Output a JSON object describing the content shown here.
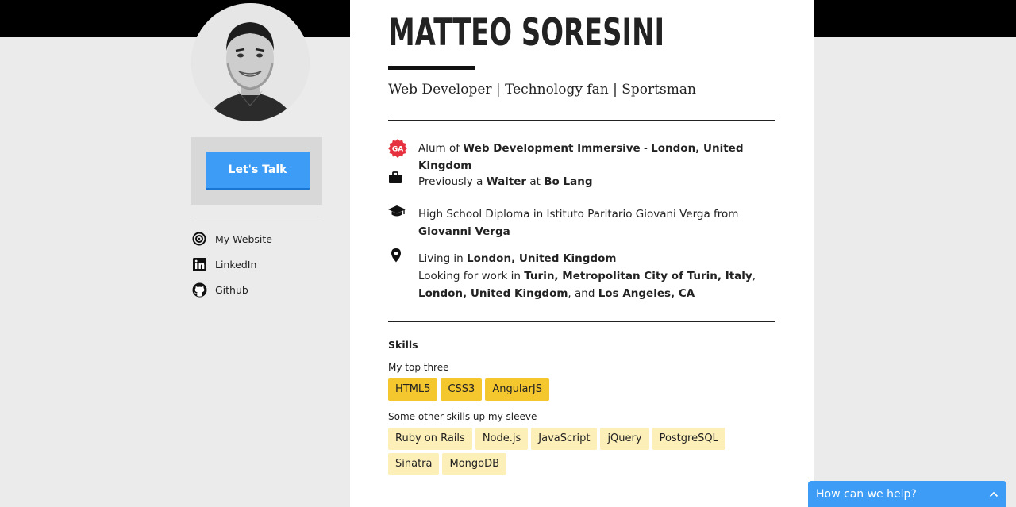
{
  "profile": {
    "name": "MATTEO SORESINI",
    "tagline": "Web Developer | Technology fan | Sportsman"
  },
  "sidebar": {
    "cta_label": "Let's Talk",
    "links": [
      {
        "label": "My Website",
        "icon": "website-target-icon"
      },
      {
        "label": "LinkedIn",
        "icon": "linkedin-icon"
      },
      {
        "label": "Github",
        "icon": "github-icon"
      }
    ]
  },
  "facts": {
    "alum": {
      "prefix": "Alum of ",
      "program": "Web Development Immersive",
      "sep": " - ",
      "location": "London, United Kingdom",
      "icon": "ga-badge-icon"
    },
    "job": {
      "prefix": "Previously a ",
      "role": "Waiter",
      "at": " at ",
      "company": "Bo Lang",
      "icon": "briefcase-icon"
    },
    "education": {
      "text": "High School Diploma in Istituto Paritario Giovani Verga from ",
      "school": "Giovanni Verga",
      "icon": "graduation-cap-icon"
    },
    "location": {
      "living_prefix": "Living in ",
      "living": "London, United Kingdom",
      "looking_prefix": "Looking for work in ",
      "loc1": "Turin, Metropolitan City of Turin, Italy",
      "comma": ", ",
      "loc2": "London, United Kingdom",
      "and": ", and ",
      "loc3": "Los Angeles, CA",
      "icon": "map-pin-icon"
    }
  },
  "skills": {
    "title": "Skills",
    "top_label": "My top three",
    "top": [
      "HTML5",
      "CSS3",
      "AngularJS"
    ],
    "other_label": "Some other skills up my sleeve",
    "other": [
      "Ruby on Rails",
      "Node.js",
      "JavaScript",
      "jQuery",
      "PostgreSQL",
      "Sinatra",
      "MongoDB"
    ]
  },
  "help_widget": {
    "label": "How can we help?",
    "icon": "chevron-up-icon"
  },
  "colors": {
    "accent_blue": "#3d9cf5",
    "top_skill": "#f5c72e",
    "other_skill": "#fcefb8",
    "ga_red": "#e5323e"
  }
}
